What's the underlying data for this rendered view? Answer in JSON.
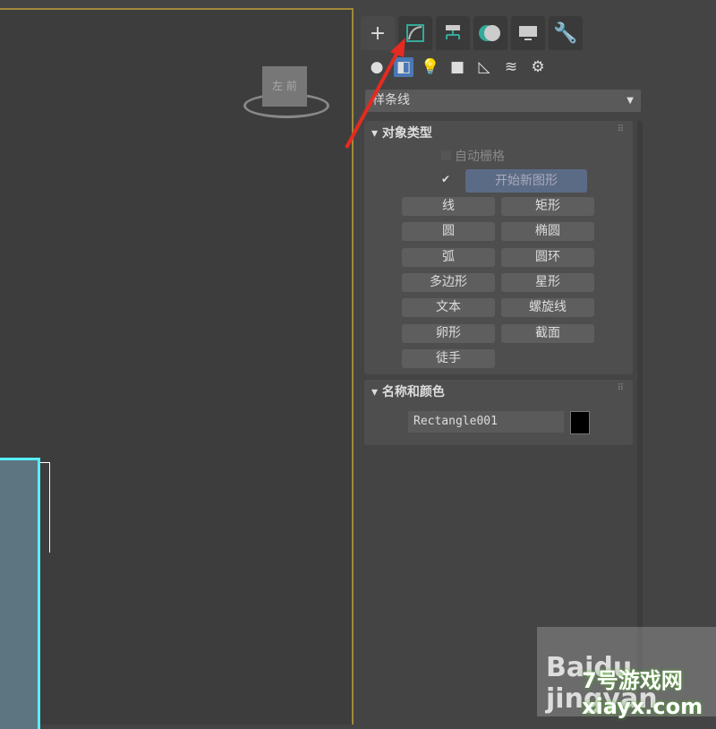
{
  "viewport": {
    "viewcube_label": "左 前"
  },
  "command_panel": {
    "tabs": [
      {
        "name": "create",
        "icon": "plus-icon"
      },
      {
        "name": "modify",
        "icon": "spline-curve-icon"
      },
      {
        "name": "hierarchy",
        "icon": "hierarchy-icon"
      },
      {
        "name": "motion",
        "icon": "motion-icon"
      },
      {
        "name": "display",
        "icon": "monitor-icon"
      },
      {
        "name": "utilities",
        "icon": "wrench-icon"
      }
    ],
    "subtypes": [
      "geometry-icon",
      "shapes-icon",
      "lights-icon",
      "cameras-icon",
      "helpers-icon",
      "spacewarps-icon",
      "systems-icon"
    ],
    "category_dropdown": "样条线",
    "object_type": {
      "title": "对象类型",
      "autogrid": "自动栅格",
      "start_new_shape": "开始新图形",
      "buttons": [
        "线",
        "矩形",
        "圆",
        "椭圆",
        "弧",
        "圆环",
        "多边形",
        "星形",
        "文本",
        "螺旋线",
        "卵形",
        "截面",
        "徒手"
      ]
    },
    "name_color": {
      "title": "名称和颜色",
      "name_value": "Rectangle001",
      "color": "#000000"
    }
  },
  "watermark": {
    "text": "7号游戏网 xiayx.com",
    "baidu": "Baidu jingyan"
  }
}
